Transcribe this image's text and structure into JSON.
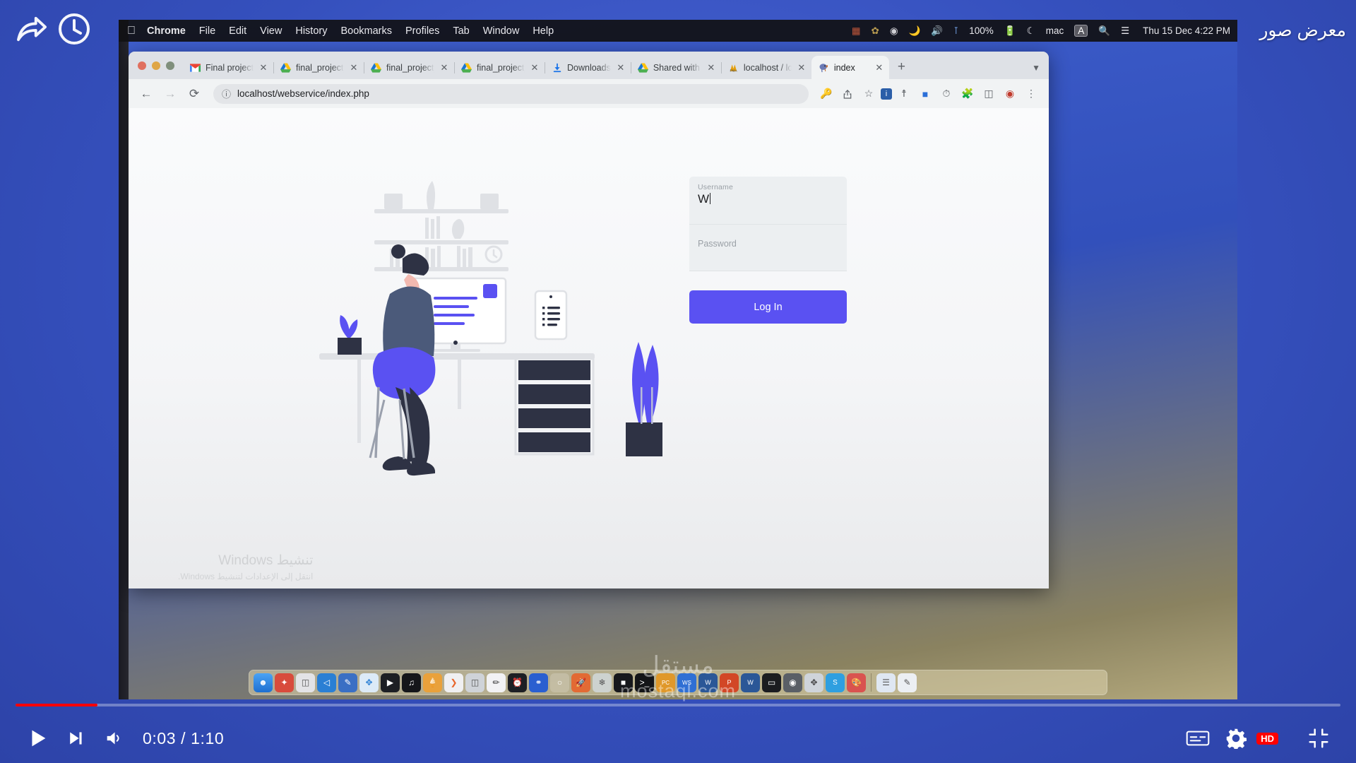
{
  "video": {
    "title": "معرض صور",
    "current_time": "0:03",
    "duration": "1:10",
    "time_display": "0:03 / 1:10",
    "progress_percent": 6.2,
    "quality_badge": "HD",
    "progress_color": "#ff0000",
    "icons": {
      "share": "share-icon",
      "history": "history-clock-icon",
      "play": "play-icon",
      "next": "next-track-icon",
      "volume": "volume-icon",
      "subtitles": "subtitles-icon",
      "settings": "settings-gear-icon",
      "fullscreen": "exit-fullscreen-icon"
    },
    "watermark_logo": "مستقل",
    "watermark_text": "mostaql.com"
  },
  "menubar": {
    "apple": "",
    "items": [
      {
        "label": "Chrome",
        "bold": true
      },
      {
        "label": "File",
        "bold": false
      },
      {
        "label": "Edit",
        "bold": false
      },
      {
        "label": "View",
        "bold": false
      },
      {
        "label": "History",
        "bold": false
      },
      {
        "label": "Bookmarks",
        "bold": false
      },
      {
        "label": "Profiles",
        "bold": false
      },
      {
        "label": "Tab",
        "bold": false
      },
      {
        "label": "Window",
        "bold": false
      },
      {
        "label": "Help",
        "bold": false
      }
    ],
    "status": {
      "battery_percent": "100%",
      "user": "mac",
      "input_source": "A",
      "clock": "Thu 15 Dec  4:22 PM",
      "icons": [
        "moon-icon",
        "volume-icon",
        "bluetooth-icon",
        "battery-charging-icon",
        "wifi-icon",
        "search-icon",
        "control-center-icon"
      ]
    }
  },
  "browser": {
    "window_controls": [
      "close",
      "minimize",
      "maximize"
    ],
    "tabs": [
      {
        "label": "Final project - a",
        "favicon": "gmail-icon",
        "active": false
      },
      {
        "label": "final_project_w",
        "favicon": "google-drive-icon",
        "active": false
      },
      {
        "label": "final_project_w",
        "favicon": "google-drive-icon",
        "active": false
      },
      {
        "label": "final_project_w",
        "favicon": "google-drive-icon",
        "active": false
      },
      {
        "label": "Downloads",
        "favicon": "download-icon",
        "active": false
      },
      {
        "label": "Shared with me",
        "favicon": "google-drive-icon",
        "active": false
      },
      {
        "label": "localhost / loca",
        "favicon": "phpmyadmin-icon",
        "active": false
      },
      {
        "label": "index",
        "favicon": "php-elephant-icon",
        "active": true
      }
    ],
    "new_tab_label": "+",
    "tab_close_label": "✕",
    "toolbar": {
      "back": "←",
      "forward": "→",
      "reload": "⟳",
      "url": "localhost/webservice/index.php",
      "site_info_icon": "info-circle-icon",
      "right_icons": [
        "key-icon",
        "share-icon",
        "bookmark-star-icon",
        "reader-icon",
        "cast-icon",
        "extension-puzzle-icon",
        "profile-icon",
        "extension-icon",
        "side-panel-icon",
        "app-icon",
        "menu-kebab-icon"
      ]
    }
  },
  "page": {
    "login": {
      "username_label": "Username",
      "username_value": "W",
      "password_placeholder": "Password",
      "submit_label": "Log In",
      "accent_color": "#5a51f2"
    },
    "illustration_name": "person-working-at-desk-illustration"
  },
  "windows_watermark": {
    "line1": "تنشيط Windows",
    "line2": "انتقل إلى الإعدادات لتنشيط Windows."
  },
  "dock": {
    "items": [
      "finder-icon",
      "siri-icon",
      "launchpad-icon",
      "vscode-icon",
      "xcode-icon",
      "safari-icon",
      "quicktime-icon",
      "spotify-icon",
      "ice-cream-icon",
      "swift-icon",
      "mysql-icon",
      "pen-icon",
      "apple-watch-icon",
      "firefox-icon",
      "circle-icon",
      "postman-icon",
      "photos-icon",
      "dark-app-icon",
      "terminal-icon",
      "pc-icon",
      "ws-icon",
      "word-icon",
      "powerpoint-icon",
      "word-doc-icon",
      "display-icon",
      "camera-icon",
      "compass-icon",
      "skype-icon",
      "gallery-icon",
      "separator",
      "notes-icon",
      "pages-icon"
    ]
  }
}
